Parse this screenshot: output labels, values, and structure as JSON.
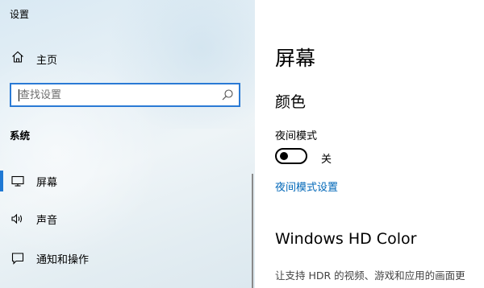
{
  "window": {
    "title": "设置"
  },
  "sidebar": {
    "home_label": "主页",
    "search": {
      "placeholder": "查找设置",
      "value": ""
    },
    "section_label": "系统",
    "items": [
      {
        "label": "屏幕",
        "icon": "monitor-icon",
        "selected": true
      },
      {
        "label": "声音",
        "icon": "speaker-icon",
        "selected": false
      },
      {
        "label": "通知和操作",
        "icon": "notification-icon",
        "selected": false
      }
    ]
  },
  "main": {
    "title": "屏幕",
    "color_section": {
      "heading": "颜色",
      "night_light_label": "夜间模式",
      "night_light_state": "关",
      "night_light_on": false,
      "settings_link": "夜间模式设置"
    },
    "hd_section": {
      "heading": "Windows HD Color",
      "description": "让支持 HDR 的视频、游戏和应用的画面更"
    }
  },
  "colors": {
    "accent": "#0067b8",
    "selection_bar": "#1e78d4"
  }
}
